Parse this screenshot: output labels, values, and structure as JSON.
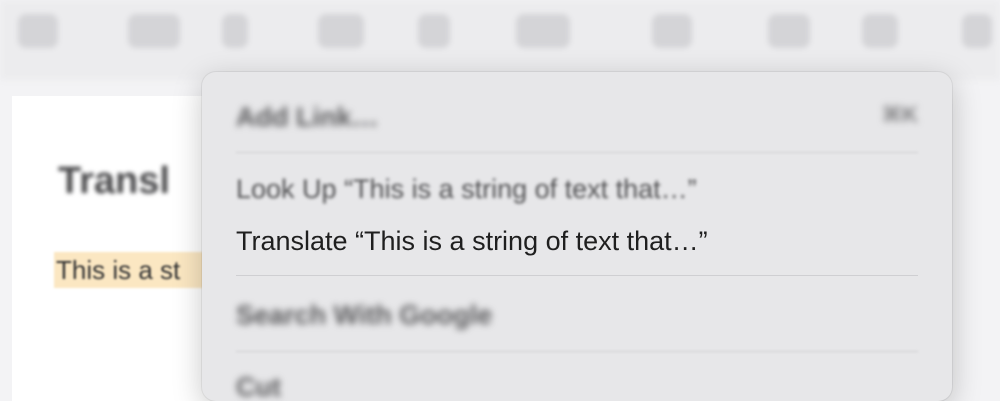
{
  "document": {
    "title": "Transl",
    "selected_text": "This is a st"
  },
  "toolbar": {
    "icons": [
      "toolbar-icon",
      "toolbar-icon",
      "toolbar-icon",
      "toolbar-icon",
      "toolbar-icon",
      "toolbar-icon",
      "toolbar-icon",
      "toolbar-icon",
      "toolbar-icon",
      "toolbar-icon"
    ]
  },
  "context_menu": {
    "add_link": {
      "label": "Add Link…",
      "shortcut": "⌘K"
    },
    "look_up": {
      "label": "Look Up “This is a string of text that…”"
    },
    "translate": {
      "label": "Translate “This is a string of text that…”"
    },
    "search": {
      "label": "Search With Google"
    },
    "cut": {
      "label": "Cut"
    }
  },
  "colors": {
    "highlight": "#fbe7c2",
    "menu_background": "#e7e7e9"
  }
}
